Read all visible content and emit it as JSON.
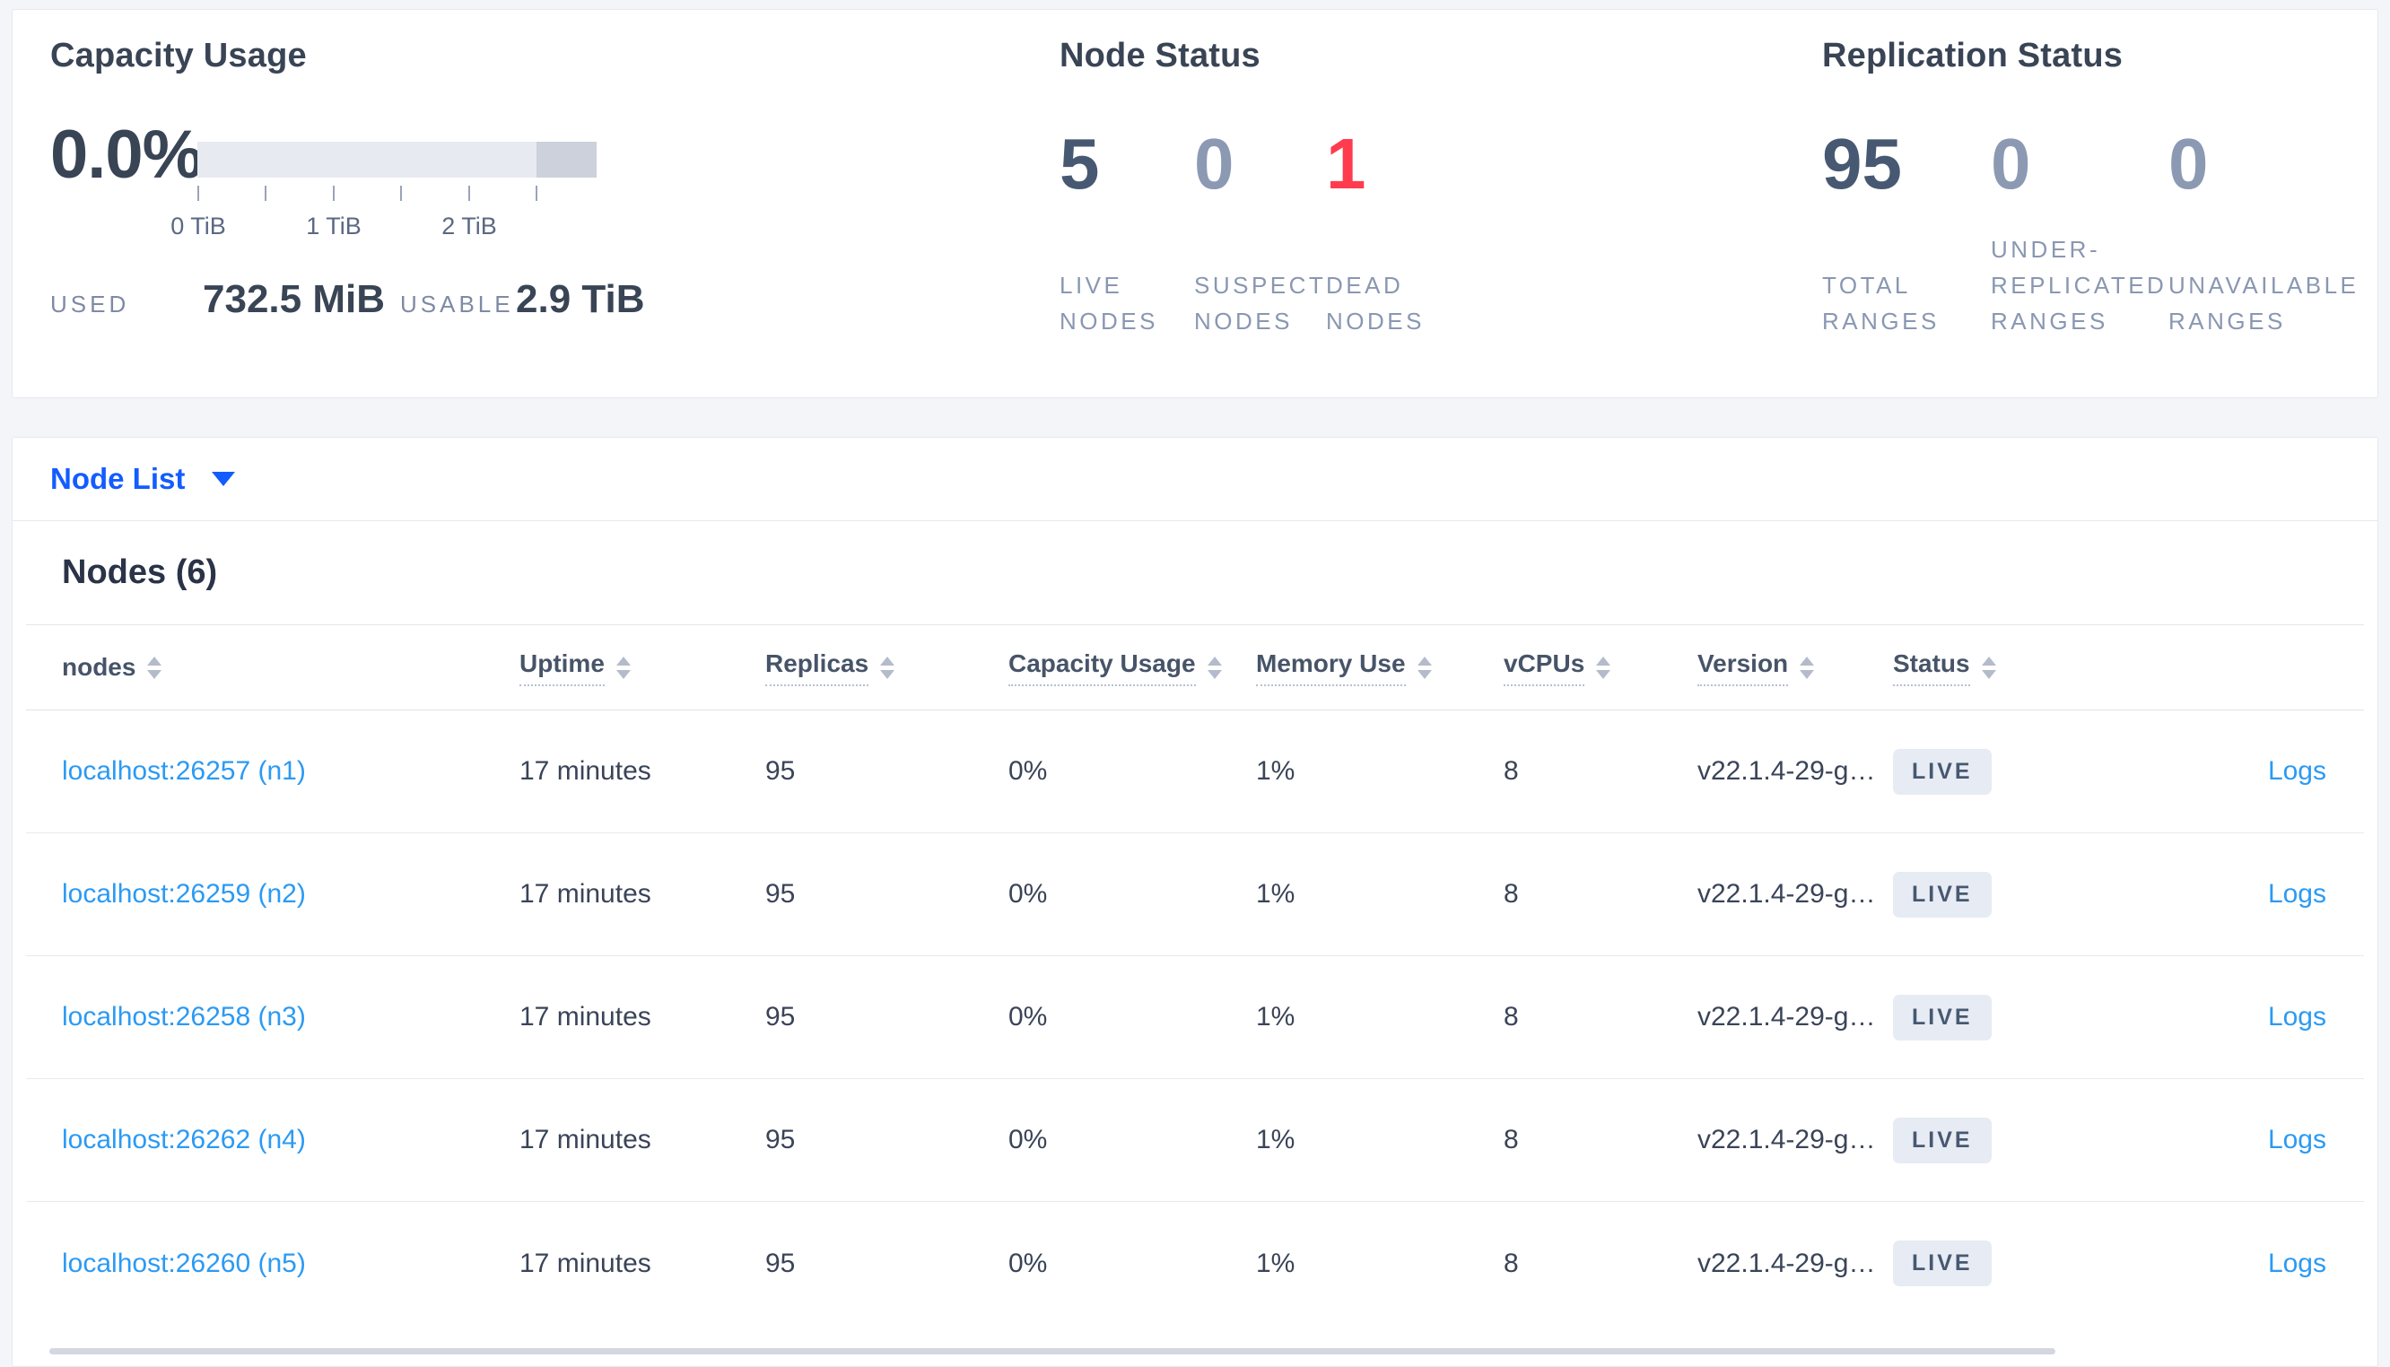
{
  "colors": {
    "page_background": "#f4f5f9",
    "selector_blue": "#135cff",
    "table_link_blue": "#2b9af3",
    "dead_red": "#ff3b4e",
    "stat_dark": "#475872",
    "stat_muted": "#8c99b3",
    "badge_background": "#e7ebf3",
    "bar_track": "#e8eaf1",
    "bar_reserved": "#cdd1dc"
  },
  "capacity": {
    "title": "Capacity Usage",
    "percent": "0.0%",
    "axis_ticks": [
      "0 TiB",
      "1 TiB",
      "2 TiB"
    ],
    "used_label": "USED",
    "used_value": "732.5 MiB",
    "usable_label": "USABLE",
    "usable_value": "2.9 TiB"
  },
  "node_status": {
    "title": "Node Status",
    "live": {
      "value": "5",
      "label": "LIVE NODES"
    },
    "suspect": {
      "value": "0",
      "label": "SUSPECT NODES"
    },
    "dead": {
      "value": "1",
      "label": "DEAD NODES"
    }
  },
  "replication_status": {
    "title": "Replication Status",
    "total": {
      "value": "95",
      "label": "TOTAL RANGES"
    },
    "under_replicated": {
      "value": "0",
      "label": "UNDER-REPLICATED RANGES"
    },
    "unavailable": {
      "value": "0",
      "label": "UNAVAILABLE RANGES"
    }
  },
  "view_selector": {
    "label": "Node List"
  },
  "nodes": {
    "title": "Nodes (6)",
    "columns": {
      "nodes": "nodes",
      "uptime": "Uptime",
      "replicas": "Replicas",
      "capacity": "Capacity Usage",
      "memory": "Memory Use",
      "vcpus": "vCPUs",
      "version": "Version",
      "status": "Status"
    },
    "rows": [
      {
        "name": "localhost:26257 (n1)",
        "uptime": "17 minutes",
        "replicas": "95",
        "capacity": "0%",
        "memory": "1%",
        "vcpus": "8",
        "version": "v22.1.4-29-g…",
        "status": "LIVE",
        "logs": "Logs"
      },
      {
        "name": "localhost:26259 (n2)",
        "uptime": "17 minutes",
        "replicas": "95",
        "capacity": "0%",
        "memory": "1%",
        "vcpus": "8",
        "version": "v22.1.4-29-g…",
        "status": "LIVE",
        "logs": "Logs"
      },
      {
        "name": "localhost:26258 (n3)",
        "uptime": "17 minutes",
        "replicas": "95",
        "capacity": "0%",
        "memory": "1%",
        "vcpus": "8",
        "version": "v22.1.4-29-g…",
        "status": "LIVE",
        "logs": "Logs"
      },
      {
        "name": "localhost:26262 (n4)",
        "uptime": "17 minutes",
        "replicas": "95",
        "capacity": "0%",
        "memory": "1%",
        "vcpus": "8",
        "version": "v22.1.4-29-g…",
        "status": "LIVE",
        "logs": "Logs"
      },
      {
        "name": "localhost:26260 (n5)",
        "uptime": "17 minutes",
        "replicas": "95",
        "capacity": "0%",
        "memory": "1%",
        "vcpus": "8",
        "version": "v22.1.4-29-g…",
        "status": "LIVE",
        "logs": "Logs"
      }
    ]
  }
}
